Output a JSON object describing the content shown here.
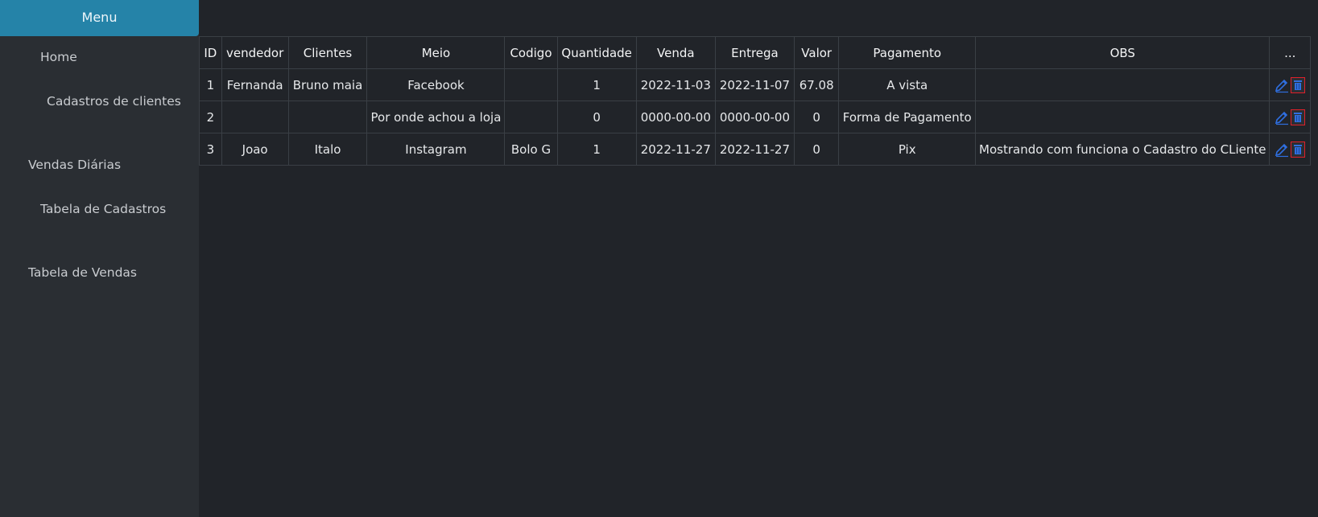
{
  "sidebar": {
    "menu_title": "Menu",
    "items": [
      {
        "label": "Home"
      },
      {
        "label": "Cadastros de clientes"
      },
      {
        "label": "Vendas Diárias"
      },
      {
        "label": "Tabela de Cadastros"
      },
      {
        "label": "Tabela de Vendas"
      }
    ]
  },
  "table": {
    "headers": [
      "ID",
      "vendedor",
      "Clientes",
      "Meio",
      "Codigo",
      "Quantidade",
      "Venda",
      "Entrega",
      "Valor",
      "Pagamento",
      "OBS",
      "..."
    ],
    "rows": [
      {
        "id": "1",
        "vendedor": "Fernanda",
        "clientes": "Bruno maia",
        "meio": "Facebook",
        "codigo": "",
        "quantidade": "1",
        "venda": "2022-11-03",
        "entrega": "2022-11-07",
        "valor": "67.08",
        "pagamento": "A vista",
        "obs": ""
      },
      {
        "id": "2",
        "vendedor": "",
        "clientes": "",
        "meio": "Por onde achou a loja",
        "codigo": "",
        "quantidade": "0",
        "venda": "0000-00-00",
        "entrega": "0000-00-00",
        "valor": "0",
        "pagamento": "Forma de Pagamento",
        "obs": ""
      },
      {
        "id": "3",
        "vendedor": "Joao",
        "clientes": "Italo",
        "meio": "Instagram",
        "codigo": "Bolo G",
        "quantidade": "1",
        "venda": "2022-11-27",
        "entrega": "2022-11-27",
        "valor": "0",
        "pagamento": "Pix",
        "obs": "Mostrando com funciona o Cadastro do CLiente"
      }
    ],
    "row_actions": {
      "edit_icon": "pencil-icon",
      "delete_icon": "trash-icon"
    }
  },
  "colors": {
    "menu_header": "#2583a8",
    "sidebar_bg": "#2a2e33",
    "page_bg": "#212429",
    "edit_icon": "#2f6fe0",
    "delete_icon_border": "#e0202a",
    "delete_icon_fill": "#2f6fe0"
  }
}
